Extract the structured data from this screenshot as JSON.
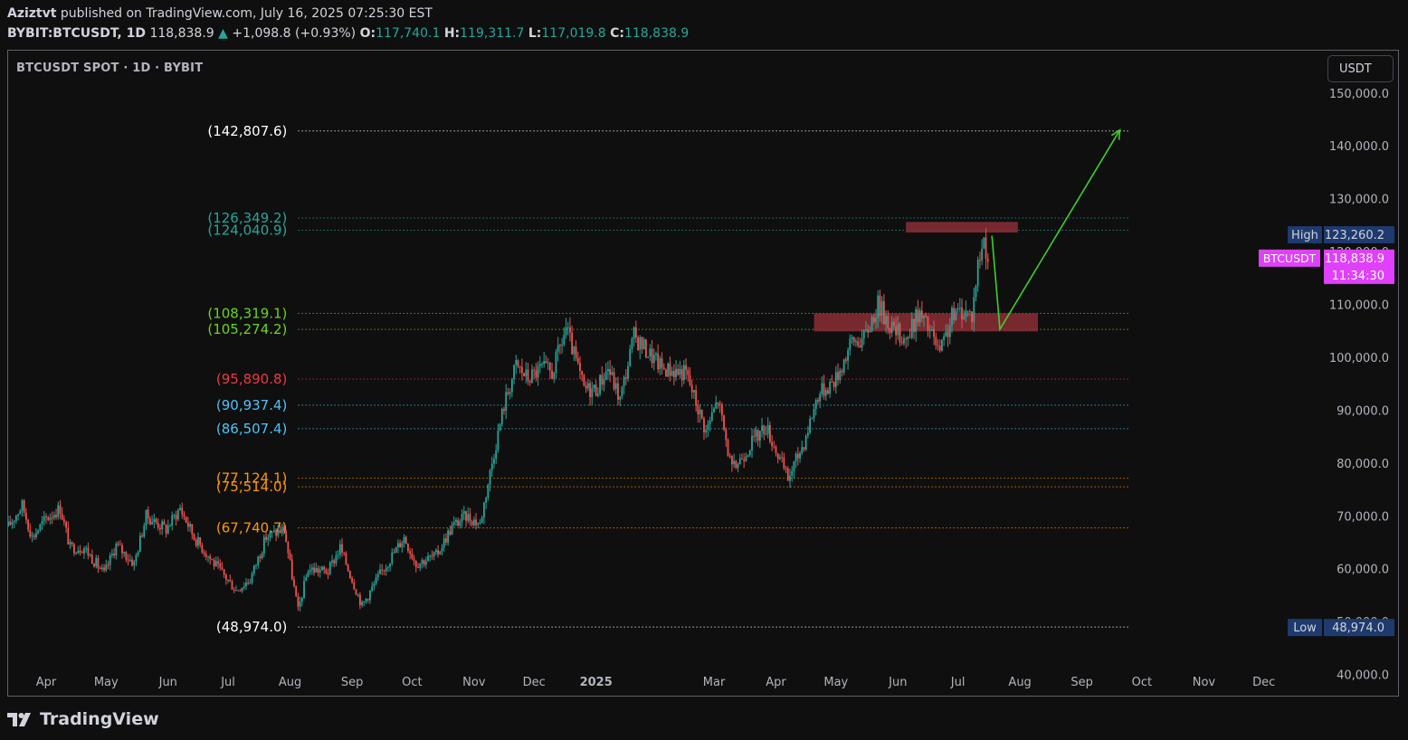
{
  "header": {
    "author": "Aziztvt",
    "published_text": "published on TradingView.com, July 16, 2025 07:25:30 EST",
    "symbol": "BYBIT:BTCUSDT, 1D",
    "last": "118,838.9",
    "change_arrow": "▲",
    "change": "+1,098.8 (+0.93%)",
    "o_label": "O:",
    "o_value": "117,740.1",
    "h_label": "H:",
    "h_value": "119,311.7",
    "l_label": "L:",
    "l_value": "117,019.8",
    "c_label": "C:",
    "c_value": "118,838.9"
  },
  "chart_title": "BTCUSDT SPOT · 1D · BYBIT",
  "currency_button": "USDT",
  "footer": {
    "brand": "TradingView"
  },
  "colors": {
    "up": "#26a69a",
    "down": "#ef5350",
    "background": "#0f0f0f",
    "zone": "#8b2e35",
    "arrow": "#3ecf2a",
    "current_price_badge": "#e040fb",
    "high_low_badge": "#1e3a6e"
  },
  "chart_data": {
    "type": "candlestick",
    "x_range": [
      "2024-03-13",
      "2025-12-31"
    ],
    "ylim": [
      36000,
      158000
    ],
    "grid": false,
    "x_ticks": [
      {
        "label": "Apr",
        "date": "2024-04-01",
        "bold": false
      },
      {
        "label": "May",
        "date": "2024-05-01",
        "bold": false
      },
      {
        "label": "Jun",
        "date": "2024-06-01",
        "bold": false
      },
      {
        "label": "Jul",
        "date": "2024-07-01",
        "bold": false
      },
      {
        "label": "Aug",
        "date": "2024-08-01",
        "bold": false
      },
      {
        "label": "Sep",
        "date": "2024-09-01",
        "bold": false
      },
      {
        "label": "Oct",
        "date": "2024-10-01",
        "bold": false
      },
      {
        "label": "Nov",
        "date": "2024-11-01",
        "bold": false
      },
      {
        "label": "Dec",
        "date": "2024-12-01",
        "bold": false
      },
      {
        "label": "2025",
        "date": "2025-01-01",
        "bold": true
      },
      {
        "label": "Mar",
        "date": "2025-03-01",
        "bold": false
      },
      {
        "label": "Apr",
        "date": "2025-04-01",
        "bold": false
      },
      {
        "label": "May",
        "date": "2025-05-01",
        "bold": false
      },
      {
        "label": "Jun",
        "date": "2025-06-01",
        "bold": false
      },
      {
        "label": "Jul",
        "date": "2025-07-01",
        "bold": false
      },
      {
        "label": "Aug",
        "date": "2025-08-01",
        "bold": false
      },
      {
        "label": "Sep",
        "date": "2025-09-01",
        "bold": false
      },
      {
        "label": "Oct",
        "date": "2025-10-01",
        "bold": false
      },
      {
        "label": "Nov",
        "date": "2025-11-01",
        "bold": false
      },
      {
        "label": "Dec",
        "date": "2025-12-01",
        "bold": false
      }
    ],
    "y_ticks": [
      "150,000.0",
      "140,000.0",
      "130,000.0",
      "120,000.0",
      "110,000.0",
      "100,000.0",
      "90,000.0",
      "80,000.0",
      "70,000.0",
      "60,000.0",
      "50,000.0",
      "40,000.0"
    ],
    "y_tick_values": [
      150000,
      140000,
      130000,
      120000,
      110000,
      100000,
      90000,
      80000,
      70000,
      60000,
      50000,
      40000
    ],
    "price_path": [
      [
        "2024-03-13",
        68000
      ],
      [
        "2024-03-20",
        72000
      ],
      [
        "2024-03-25",
        66000
      ],
      [
        "2024-04-01",
        69500
      ],
      [
        "2024-04-08",
        71500
      ],
      [
        "2024-04-13",
        64000
      ],
      [
        "2024-04-20",
        64000
      ],
      [
        "2024-04-30",
        59000
      ],
      [
        "2024-05-06",
        64500
      ],
      [
        "2024-05-15",
        61000
      ],
      [
        "2024-05-21",
        70000
      ],
      [
        "2024-05-31",
        67500
      ],
      [
        "2024-06-07",
        71500
      ],
      [
        "2024-06-14",
        66000
      ],
      [
        "2024-06-24",
        61000
      ],
      [
        "2024-07-05",
        56000
      ],
      [
        "2024-07-12",
        58000
      ],
      [
        "2024-07-20",
        66000
      ],
      [
        "2024-07-29",
        67500
      ],
      [
        "2024-08-05",
        52000
      ],
      [
        "2024-08-10",
        60000
      ],
      [
        "2024-08-20",
        59500
      ],
      [
        "2024-08-26",
        64000
      ],
      [
        "2024-09-06",
        53000
      ],
      [
        "2024-09-15",
        59000
      ],
      [
        "2024-09-27",
        66000
      ],
      [
        "2024-10-03",
        61000
      ],
      [
        "2024-10-13",
        62500
      ],
      [
        "2024-10-21",
        68000
      ],
      [
        "2024-10-28",
        70000
      ],
      [
        "2024-11-04",
        68500
      ],
      [
        "2024-11-11",
        82000
      ],
      [
        "2024-11-16",
        91000
      ],
      [
        "2024-11-22",
        98500
      ],
      [
        "2024-11-28",
        96000
      ],
      [
        "2024-12-05",
        98000
      ],
      [
        "2024-12-10",
        97000
      ],
      [
        "2024-12-17",
        105500
      ],
      [
        "2024-12-26",
        94000
      ],
      [
        "2025-01-01",
        94000
      ],
      [
        "2025-01-07",
        98000
      ],
      [
        "2025-01-13",
        92000
      ],
      [
        "2025-01-20",
        104000
      ],
      [
        "2025-01-27",
        101000
      ],
      [
        "2025-02-03",
        98000
      ],
      [
        "2025-02-15",
        97000
      ],
      [
        "2025-02-25",
        86000
      ],
      [
        "2025-03-03",
        92000
      ],
      [
        "2025-03-10",
        78500
      ],
      [
        "2025-03-20",
        84000
      ],
      [
        "2025-03-27",
        87000
      ],
      [
        "2025-04-07",
        77000
      ],
      [
        "2025-04-15",
        84000
      ],
      [
        "2025-04-22",
        93000
      ],
      [
        "2025-05-01",
        96000
      ],
      [
        "2025-05-09",
        103000
      ],
      [
        "2025-05-15",
        103500
      ],
      [
        "2025-05-22",
        110000
      ],
      [
        "2025-05-30",
        105000
      ],
      [
        "2025-06-06",
        103500
      ],
      [
        "2025-06-11",
        108500
      ],
      [
        "2025-06-17",
        105000
      ],
      [
        "2025-06-22",
        100500
      ],
      [
        "2025-06-28",
        107500
      ],
      [
        "2025-07-03",
        109000
      ],
      [
        "2025-07-08",
        108000
      ],
      [
        "2025-07-11",
        117500
      ],
      [
        "2025-07-14",
        122500
      ],
      [
        "2025-07-16",
        118838.9
      ]
    ],
    "levels": [
      {
        "label": "(142,807.6)",
        "value": 142807.6,
        "color": "#ffffff"
      },
      {
        "label": "(126,349.2)",
        "value": 126349.2,
        "color": "#26a69a"
      },
      {
        "label": "(124,040.9)",
        "value": 124040.9,
        "color": "#26a69a"
      },
      {
        "label": "(108,319.1)",
        "value": 108319.1,
        "color": "#6bd41e"
      },
      {
        "label": "(105,274.2)",
        "value": 105274.2,
        "color": "#6bd41e"
      },
      {
        "label": "(95,890.8)",
        "value": 95890.8,
        "color": "#f23645"
      },
      {
        "label": "(90,937.4)",
        "value": 90937.4,
        "color": "#4fc3f7"
      },
      {
        "label": "(86,507.4)",
        "value": 86507.4,
        "color": "#4fc3f7"
      },
      {
        "label": "(77,124.1)",
        "value": 77124.1,
        "color": "#ff9800"
      },
      {
        "label": "(75,514.0)",
        "value": 75514.0,
        "color": "#ff9800"
      },
      {
        "label": "(67,740.7)",
        "value": 67740.7,
        "color": "#ff9800"
      },
      {
        "label": "(48,974.0)",
        "value": 48974.0,
        "color": "#ffffff"
      }
    ],
    "levels_x_range": [
      "2024-08-05",
      "2025-09-25"
    ],
    "zones": [
      {
        "x": [
          "2025-06-05",
          "2025-07-31"
        ],
        "y": [
          125600,
          123600
        ]
      },
      {
        "x": [
          "2025-04-20",
          "2025-08-10"
        ],
        "y": [
          108300,
          104900
        ]
      }
    ],
    "projection": [
      [
        "2025-07-18",
        123000
      ],
      [
        "2025-07-22",
        105300
      ],
      [
        "2025-09-20",
        143000
      ]
    ],
    "badges": [
      {
        "label": "High",
        "value": "123,260.2",
        "price": 123260.2
      },
      {
        "label": "BTCUSDT",
        "value": "118,838.9",
        "price": 118838.9,
        "countdown": "11:34:30"
      },
      {
        "label": "Low",
        "value": "48,974.0",
        "price": 48974.0
      }
    ]
  }
}
